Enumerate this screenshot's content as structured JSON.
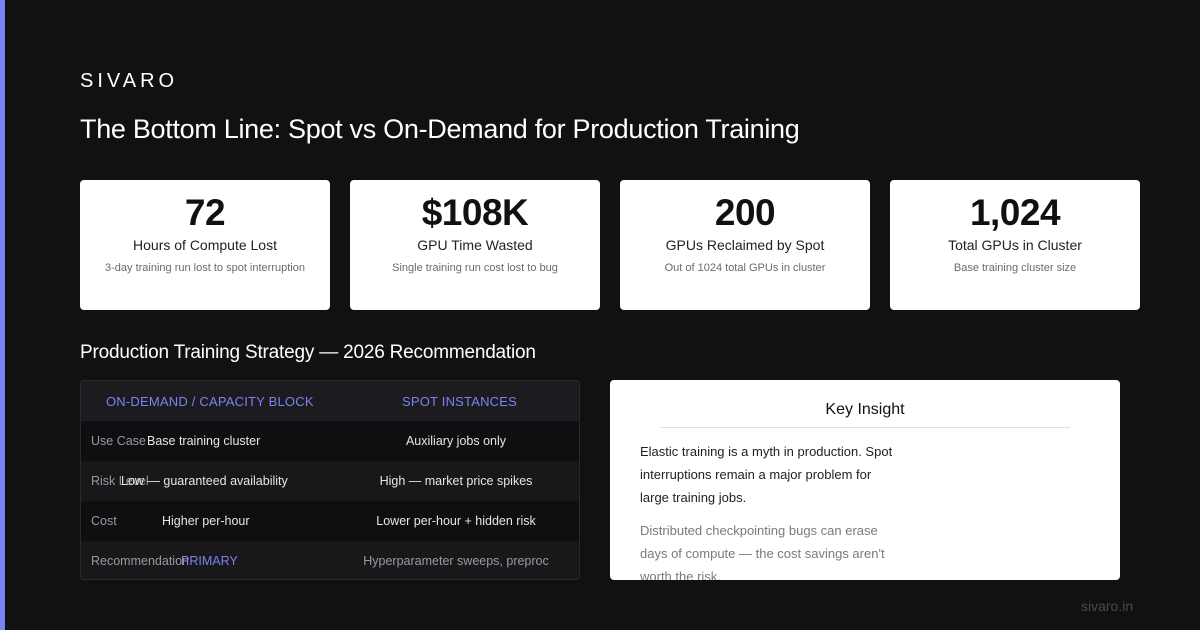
{
  "brand": "SIVARO",
  "title": "The Bottom Line: Spot vs On-Demand for Production Training",
  "stats": [
    {
      "value": "72",
      "label": "Hours of Compute Lost",
      "sub": "3-day training run lost to spot interruption"
    },
    {
      "value": "$108K",
      "label": "GPU Time Wasted",
      "sub": "Single training run cost lost to bug"
    },
    {
      "value": "200",
      "label": "GPUs Reclaimed by Spot",
      "sub": "Out of 1024 total GPUs in cluster"
    },
    {
      "value": "1,024",
      "label": "Total GPUs in Cluster",
      "sub": "Base training cluster size"
    }
  ],
  "section_title": "Production Training Strategy — 2026 Recommendation",
  "table": {
    "headers": [
      "ON-DEMAND / CAPACITY BLOCK",
      "SPOT INSTANCES"
    ],
    "rows": [
      {
        "label": "Use Case",
        "ondemand": "Base training cluster",
        "spot": "Auxiliary jobs only"
      },
      {
        "label": "Risk Level",
        "ondemand": "Low — guaranteed availability",
        "spot": "High — market price spikes"
      },
      {
        "label": "Cost",
        "ondemand": "Higher per-hour",
        "spot": "Lower per-hour + hidden risk"
      },
      {
        "label": "Recommendation",
        "ondemand": "PRIMARY",
        "spot": "Hyperparameter sweeps, preproc"
      }
    ]
  },
  "insight": {
    "title": "Key Insight",
    "p1": "Elastic training is a myth in production. Spot interruptions remain a major problem for large training jobs.",
    "p2": "Distributed checkpointing bugs can erase days of compute — the cost savings aren't worth the risk."
  },
  "footer": "sivaro.in",
  "colors": {
    "accent": "#7c83f0",
    "background": "#111111",
    "card": "#ffffff"
  }
}
